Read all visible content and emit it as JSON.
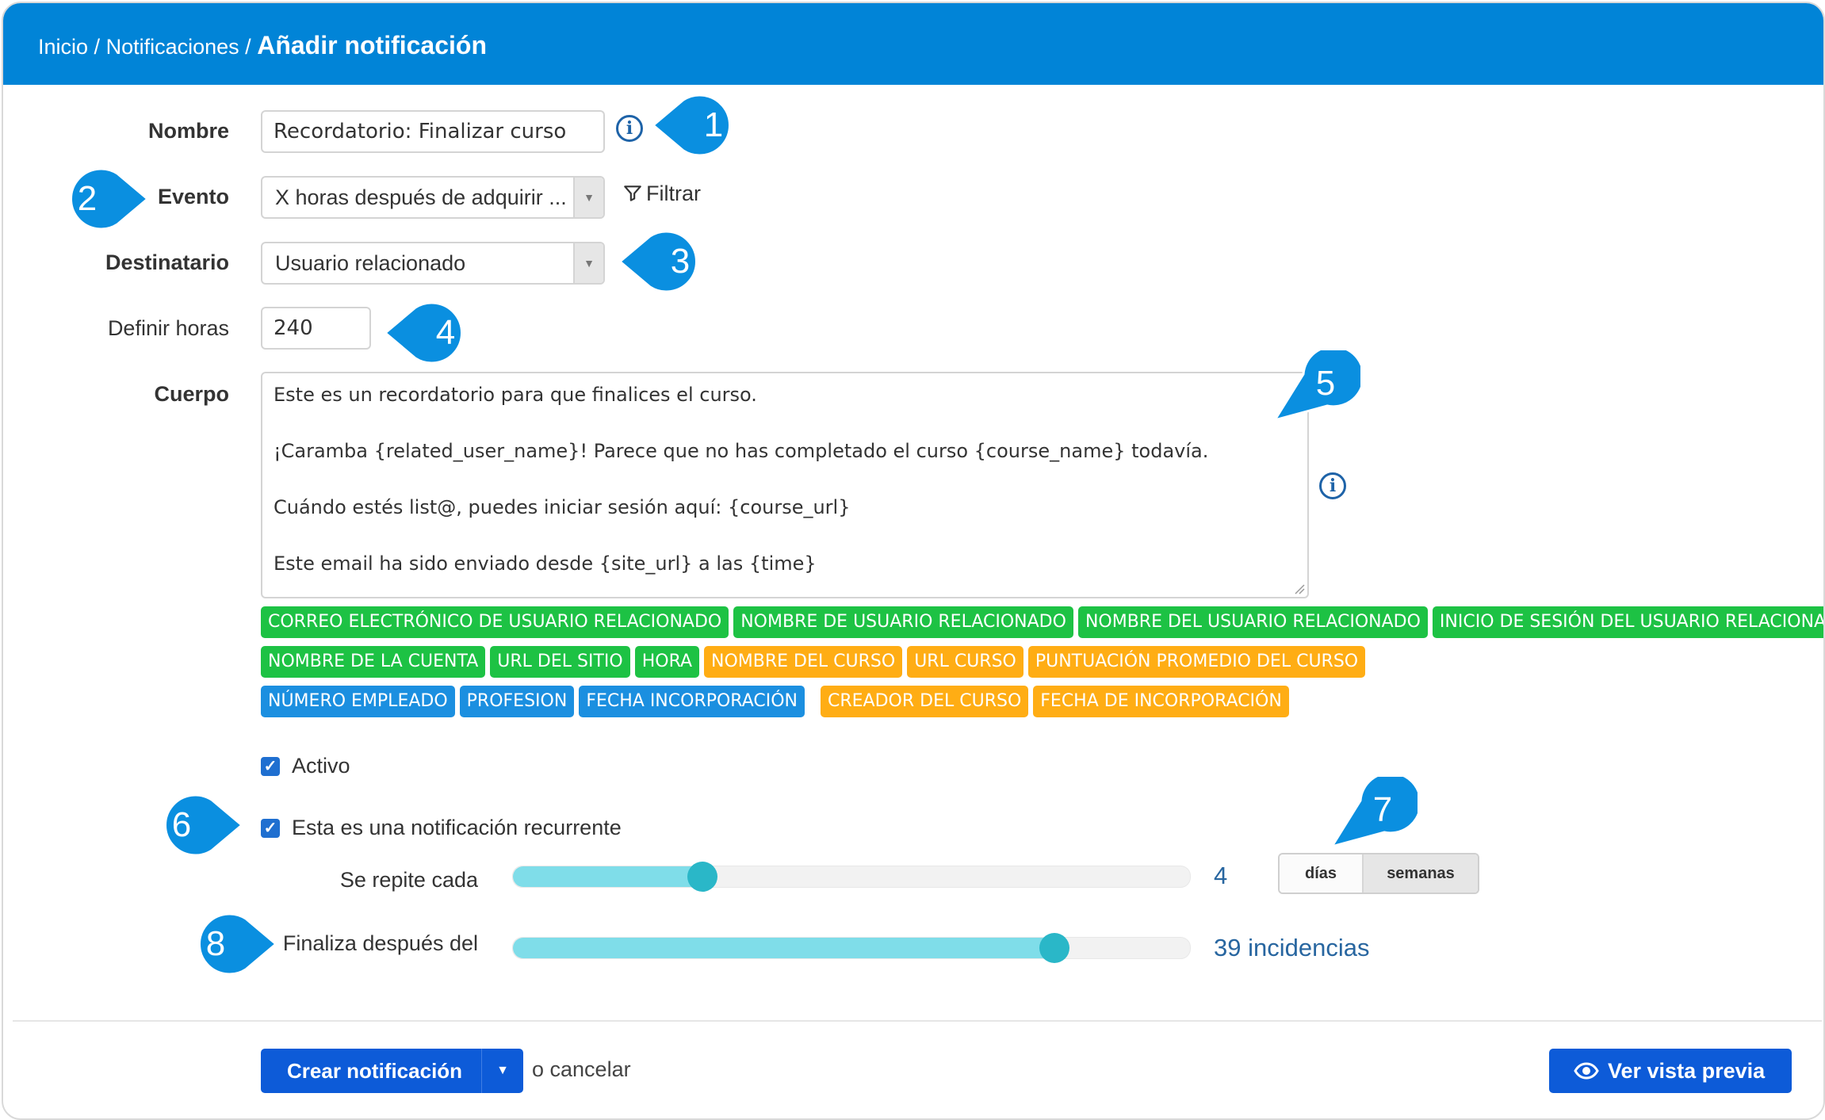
{
  "breadcrumb": {
    "home": "Inicio",
    "sep1": "/",
    "section": "Notificaciones",
    "sep2": "/",
    "current": "Añadir notificación"
  },
  "form": {
    "nombre_label": "Nombre",
    "nombre_value": "Recordatorio: Finalizar curso",
    "evento_label": "Evento",
    "evento_value": "X horas después de adquirir ...",
    "filter_label": "Filtrar",
    "destinatario_label": "Destinatario",
    "destinatario_value": "Usuario relacionado",
    "horas_label": "Definir horas",
    "horas_value": "240",
    "cuerpo_label": "Cuerpo",
    "cuerpo_value": "Este es un recordatorio para que finalices el curso.\n\n¡Caramba {related_user_name}! Parece que no has completado el curso {course_name} todavía.\n\nCuándo estés list@, puedes iniciar sesión aquí: {course_url}\n\nEste email ha sido enviado desde {site_url} a las {time}"
  },
  "tags": {
    "row1": [
      "Correo electrónico de usuario relacionado",
      "Nombre de usuario relacionado",
      "Nombre del usuario relacionado",
      "Inicio de sesión del usuario relacionado"
    ],
    "row2": [
      "Nombre de la cuenta",
      "URL del sitio",
      "Hora",
      "Nombre del curso",
      "URL curso",
      "Puntuación promedio del curso"
    ],
    "row3": [
      "Número empleado",
      "Profesion",
      "Fecha incorporación",
      "Creador del curso",
      "Fecha de incorporación"
    ]
  },
  "colors": {
    "header": "#0184d7",
    "tag_green": "#1dc244",
    "tag_orange": "#ffad14",
    "tag_blue": "#1b8fe0",
    "callout": "#0a8fe0",
    "primary": "#0d5bd8"
  },
  "options": {
    "activo_label": "Activo",
    "activo_checked": true,
    "recurrente_label": "Esta es una notificación recurrente",
    "recurrente_checked": true,
    "repite_label": "Se repite cada",
    "repite_value": "4",
    "repite_level": 0.28,
    "unit_days": "días",
    "unit_weeks": "semanas",
    "unit_selected": "semanas",
    "finaliza_label": "Finaliza después del",
    "finaliza_value": "39 incidencias",
    "finaliza_level": 0.8
  },
  "footer": {
    "create_label": "Crear notificación",
    "cancel_label": "o cancelar",
    "preview_label": "Ver vista previa"
  },
  "callouts": {
    "c1": "1",
    "c2": "2",
    "c3": "3",
    "c4": "4",
    "c5": "5",
    "c6": "6",
    "c7": "7",
    "c8": "8"
  }
}
